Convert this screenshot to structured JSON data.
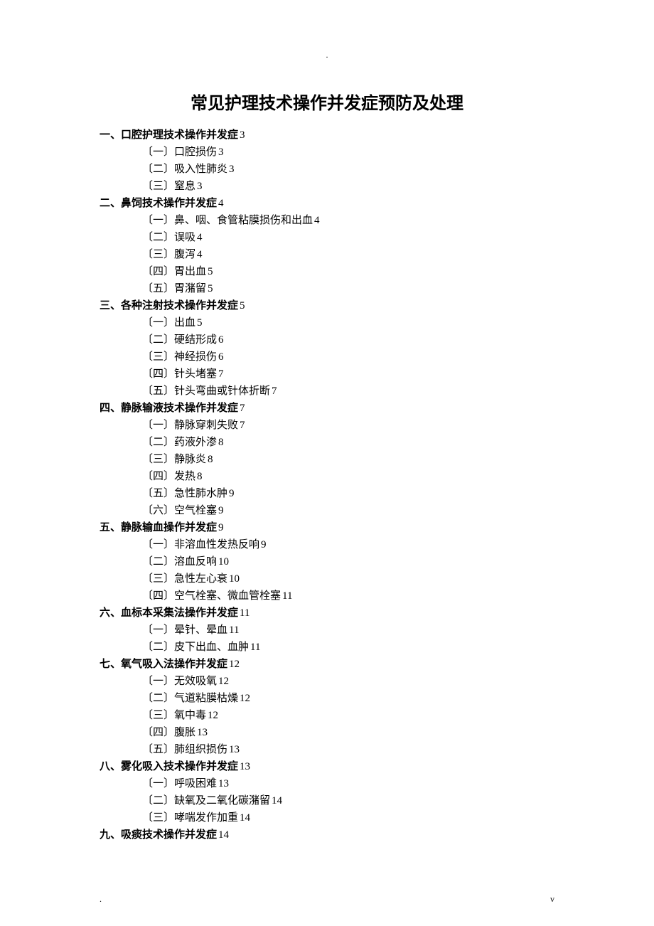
{
  "top_marker": ".",
  "title": "常见护理技术操作并发症预防及处理",
  "sections": [
    {
      "heading": "一、口腔护理技术操作并发症",
      "page": "3",
      "items": [
        {
          "label": "〔一〕口腔损伤",
          "page": "3"
        },
        {
          "label": "〔二〕吸入性肺炎",
          "page": "3"
        },
        {
          "label": "〔三〕窒息",
          "page": "3"
        }
      ]
    },
    {
      "heading": "二、鼻饲技术操作并发症",
      "page": "4",
      "items": [
        {
          "label": "〔一〕鼻、咽、食管粘膜损伤和出血",
          "page": "4"
        },
        {
          "label": "〔二〕误吸",
          "page": "4"
        },
        {
          "label": "〔三〕腹泻",
          "page": "4"
        },
        {
          "label": "〔四〕胃出血",
          "page": "5"
        },
        {
          "label": "〔五〕胃潴留",
          "page": "5"
        }
      ]
    },
    {
      "heading": "三、各种注射技术操作并发症",
      "page": "5",
      "items": [
        {
          "label": "〔一〕出血",
          "page": "5"
        },
        {
          "label": "〔二〕硬结形成",
          "page": "6"
        },
        {
          "label": "〔三〕神经损伤",
          "page": "6"
        },
        {
          "label": "〔四〕针头堵塞",
          "page": "7"
        },
        {
          "label": "〔五〕针头弯曲或针体折断",
          "page": "7"
        }
      ]
    },
    {
      "heading": "四、静脉输液技术操作并发症",
      "page": "7",
      "items": [
        {
          "label": "〔一〕静脉穿刺失败",
          "page": "7"
        },
        {
          "label": "〔二〕药液外渗",
          "page": "8"
        },
        {
          "label": "〔三〕静脉炎",
          "page": "8"
        },
        {
          "label": "〔四〕发热",
          "page": "8"
        },
        {
          "label": "〔五〕急性肺水肿",
          "page": "9"
        },
        {
          "label": "〔六〕空气栓塞",
          "page": "9"
        }
      ]
    },
    {
      "heading": "五、静脉输血操作并发症",
      "page": "9",
      "items": [
        {
          "label": "〔一〕非溶血性发热反响",
          "page": "9"
        },
        {
          "label": "〔二〕溶血反响",
          "page": "10"
        },
        {
          "label": "〔三〕急性左心衰",
          "page": "10"
        },
        {
          "label": "〔四〕空气栓塞、微血管栓塞",
          "page": "11"
        }
      ]
    },
    {
      "heading": "六、血标本采集法操作并发症",
      "page": "11",
      "items": [
        {
          "label": "〔一〕晕针、晕血",
          "page": "11"
        },
        {
          "label": "〔二〕皮下出血、血肿",
          "page": "11"
        }
      ]
    },
    {
      "heading": "七、氧气吸入法操作并发症",
      "page": "12",
      "items": [
        {
          "label": "〔一〕无效吸氧",
          "page": "12"
        },
        {
          "label": "〔二〕气道粘膜枯燥",
          "page": "12"
        },
        {
          "label": "〔三〕氧中毒",
          "page": "12"
        },
        {
          "label": "〔四〕腹胀",
          "page": "13"
        },
        {
          "label": "〔五〕肺组织损伤",
          "page": "13"
        }
      ]
    },
    {
      "heading": "八、雾化吸入技术操作并发症",
      "page": "13",
      "items": [
        {
          "label": "〔一〕呼吸困难",
          "page": "13"
        },
        {
          "label": "〔二〕缺氧及二氧化碳潴留",
          "page": "14"
        },
        {
          "label": "〔三〕哮喘发作加重",
          "page": "14"
        }
      ]
    },
    {
      "heading": "九、吸痰技术操作并发症",
      "page": "14",
      "items": []
    }
  ],
  "footer_left": ".",
  "footer_right": "v"
}
